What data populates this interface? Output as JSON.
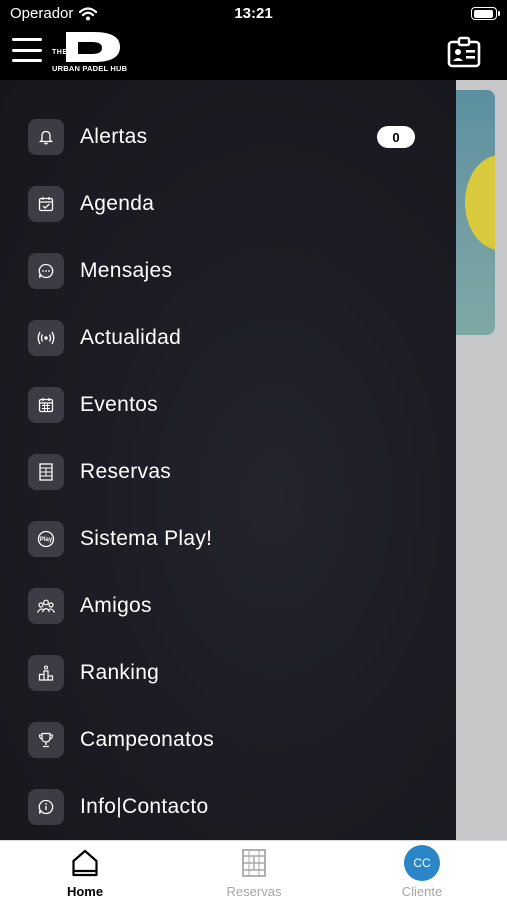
{
  "status_bar": {
    "carrier": "Operador",
    "time": "13:21",
    "battery_level": 0.95
  },
  "app_bar": {
    "logo_text_the": "THE",
    "logo_text_name": "URBAN PADEL HUB",
    "menu_icon": "hamburger-icon",
    "right_icon": "id-card-icon"
  },
  "drawer": {
    "items": [
      {
        "label": "Alertas",
        "icon": "bell-icon",
        "badge": "0"
      },
      {
        "label": "Agenda",
        "icon": "calendar-check-icon"
      },
      {
        "label": "Mensajes",
        "icon": "chat-bubble-icon"
      },
      {
        "label": "Actualidad",
        "icon": "broadcast-icon"
      },
      {
        "label": "Eventos",
        "icon": "calendar-grid-icon"
      },
      {
        "label": "Reservas",
        "icon": "court-icon"
      },
      {
        "label": "Sistema Play!",
        "icon": "play-badge-icon",
        "icon_text": "Play"
      },
      {
        "label": "Amigos",
        "icon": "friends-icon"
      },
      {
        "label": "Ranking",
        "icon": "podium-icon"
      },
      {
        "label": "Campeonatos",
        "icon": "trophy-icon"
      },
      {
        "label": "Info|Contacto",
        "icon": "info-chat-icon"
      }
    ]
  },
  "tab_bar": {
    "tabs": [
      {
        "label": "Home",
        "icon": "home-icon",
        "active": true
      },
      {
        "label": "Reservas",
        "icon": "court-icon",
        "active": false
      },
      {
        "label": "Cliente",
        "avatar_initials": "CC",
        "active": false
      }
    ]
  },
  "colors": {
    "drawer_bg": "#1c1d24",
    "icon_tile": "#3c3d44",
    "avatar": "#2a86c6",
    "tab_inactive": "#a7a7aa"
  }
}
